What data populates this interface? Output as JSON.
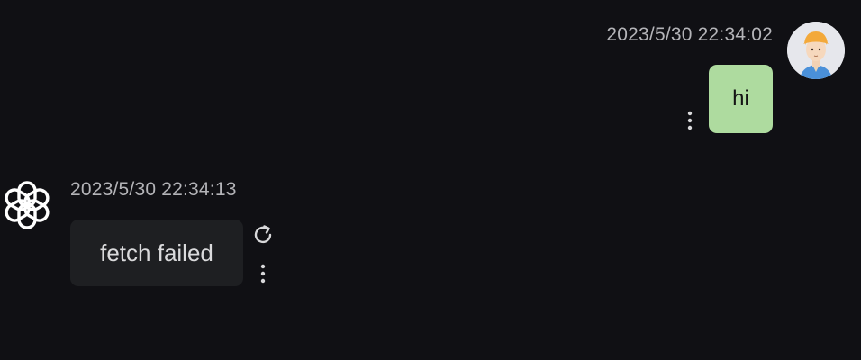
{
  "messages": [
    {
      "role": "user",
      "timestamp": "2023/5/30 22:34:02",
      "text": "hi",
      "avatar_icon": "user-avatar-icon",
      "bubble_color": "#aedb9f",
      "actions": [
        "more-options-icon"
      ]
    },
    {
      "role": "assistant",
      "timestamp": "2023/5/30 22:34:13",
      "text": "fetch failed",
      "avatar_icon": "openai-logo-icon",
      "bubble_color": "#1e1f22",
      "actions": [
        "refresh-icon",
        "more-options-icon"
      ]
    }
  ],
  "theme": {
    "background": "#101014",
    "timestamp_color": "#b4b4b8"
  }
}
